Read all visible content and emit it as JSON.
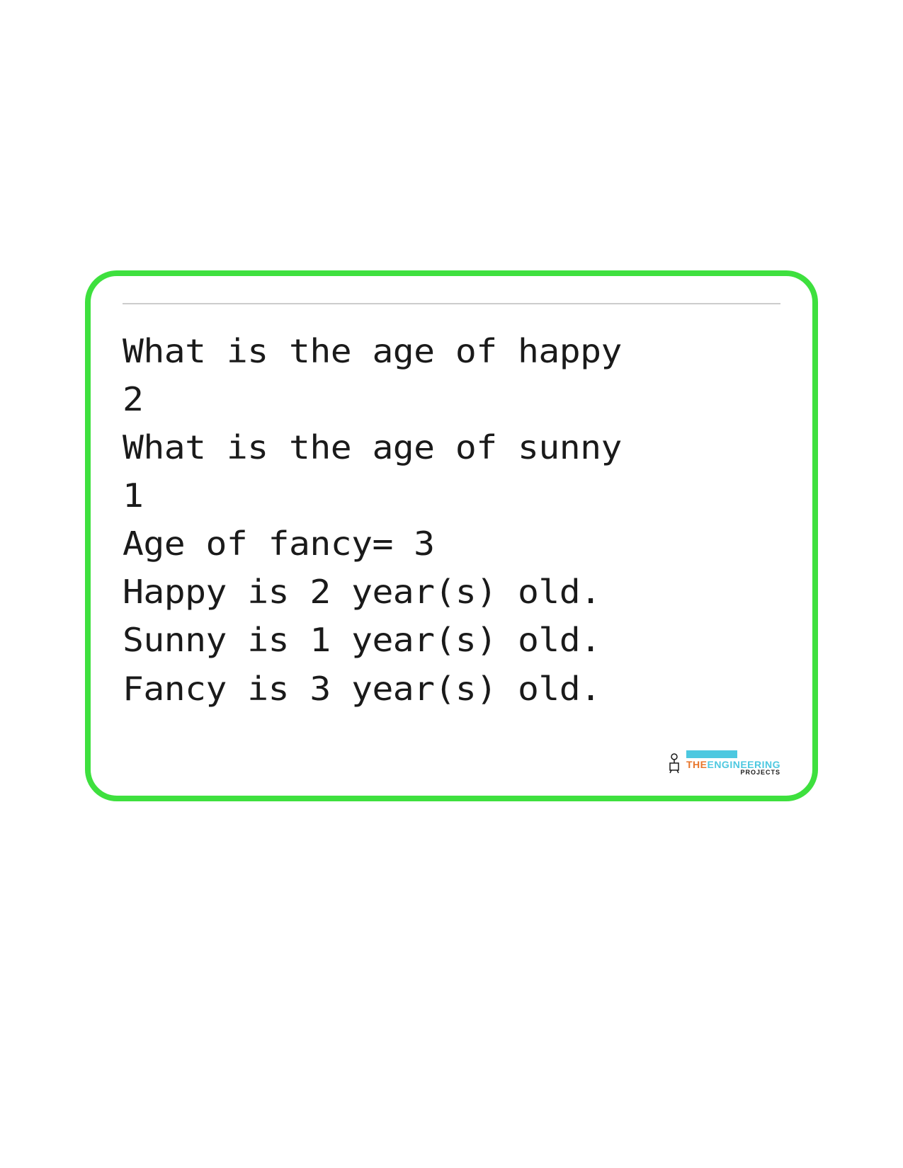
{
  "console": {
    "lines": [
      "What is the age of happy",
      "2",
      "What is the age of sunny",
      "1",
      "Age of fancy=  3",
      "Happy is 2 year(s) old.",
      "Sunny is 1 year(s) old.",
      "Fancy is 3 year(s) old."
    ]
  },
  "logo": {
    "the": "THE",
    "engineering": "ENGINEERING",
    "projects": "PROJECTS"
  }
}
